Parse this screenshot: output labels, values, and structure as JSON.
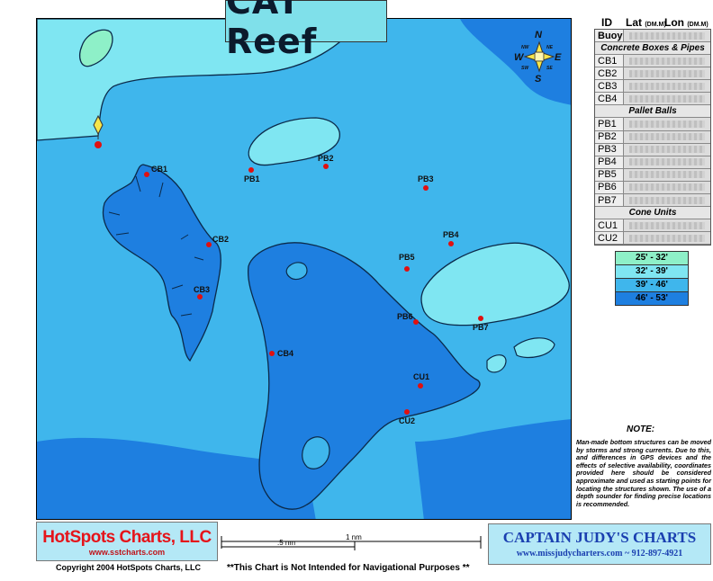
{
  "title": "CAT Reef",
  "table": {
    "header": {
      "id": "ID",
      "lat": "Lat",
      "lat_unit": "(DM.M)",
      "lon": "Lon",
      "lon_unit": "(DM.M)"
    },
    "buoy": "Buoy",
    "sections": [
      {
        "label": "Concrete Boxes & Pipes",
        "ids": [
          "CB1",
          "CB2",
          "CB3",
          "CB4"
        ]
      },
      {
        "label": "Pallet Balls",
        "ids": [
          "PB1",
          "PB2",
          "PB3",
          "PB4",
          "PB5",
          "PB6",
          "PB7"
        ]
      },
      {
        "label": "Cone Units",
        "ids": [
          "CU1",
          "CU2"
        ]
      }
    ]
  },
  "legend": [
    {
      "label": "25' - 32'",
      "color": "#8ef0c8"
    },
    {
      "label": "32' - 39'",
      "color": "#7fe6f2"
    },
    {
      "label": "39' - 46'",
      "color": "#3fb6ec"
    },
    {
      "label": "46' - 53'",
      "color": "#1e7fe0"
    }
  ],
  "compass": {
    "n": "N",
    "s": "S",
    "e": "E",
    "w": "W",
    "nw": "NW",
    "ne": "NE",
    "sw": "SW",
    "se": "SE"
  },
  "markers": {
    "cb1": "CB1",
    "cb2": "CB2",
    "cb3": "CB3",
    "cb4": "CB4",
    "pb1": "PB1",
    "pb2": "PB2",
    "pb3": "PB3",
    "pb4": "PB4",
    "pb5": "PB5",
    "pb6": "PB6",
    "pb7": "PB7",
    "cu1": "CU1",
    "cu2": "CU2"
  },
  "note": {
    "title": "NOTE:",
    "body": "Man-made bottom structures can be moved by storms and strong currents. Due to this, and differences in GPS devices and the effects of selective availability, coordinates provided here should be considered approximate and used as starting points for locating the structures shown. The use of a depth sounder for finding precise locations is recommended."
  },
  "footer": {
    "hotspots_name": "HotSpots Charts, LLC",
    "hotspots_url": "www.sstcharts.com",
    "copyright": "Copyright 2004 HotSpots Charts, LLC",
    "disclaimer": "**This Chart is Not Intended for Navigational Purposes **",
    "captain_name": "CAPTAIN JUDY'S CHARTS",
    "captain_url": "www.missjudycharters.com ~ 912-897-4921",
    "scale_full": "1 nm",
    "scale_half": ".5 nm"
  }
}
